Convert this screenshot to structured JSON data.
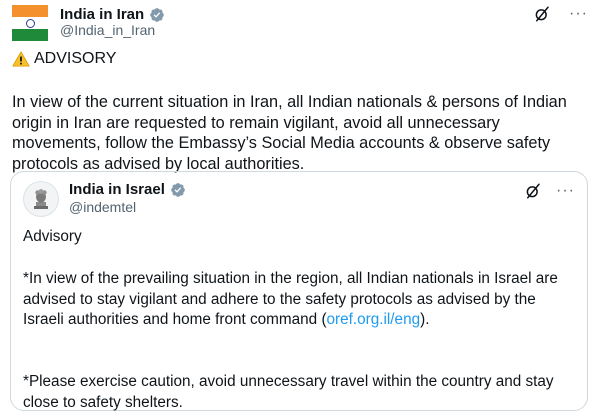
{
  "tweet": {
    "author_name": "India in Iran",
    "author_handle": "@India_in_Iran",
    "avatar": "india-flag",
    "verified_icon": "verified-badge-icon",
    "actions": {
      "grok_icon": "grok-icon",
      "more_label": "···"
    },
    "advisory_icon": "warning-icon",
    "advisory_heading": "ADVISORY",
    "body": "In view of the current situation in Iran, all Indian nationals & persons of Indian origin in Iran are requested to remain vigilant, avoid all unnecessary movements, follow the Embassy’s Social Media accounts & observe safety protocols as advised by local authorities."
  },
  "quote": {
    "author_name": "India in Israel",
    "author_handle": "@indemtel",
    "avatar": "national-emblem",
    "actions": {
      "more_label": "···"
    },
    "title": "Advisory",
    "para1_before_link": "*In view of the prevailing situation in the region, all Indian nationals in Israel are advised to stay vigilant and adhere to the safety protocols as advised by the Israeli authorities and home front command (",
    "para1_link": "oref.org.il/eng",
    "para1_after_link": ").",
    "para2": "*Please exercise caution, avoid unnecessary travel within the country and stay close to safety shelters."
  },
  "colors": {
    "text": "#0f1419",
    "secondary": "#536471",
    "link": "#1d9bf0",
    "verified": "#829aab",
    "border": "#cfd9de",
    "warning": "#f7c12b"
  }
}
